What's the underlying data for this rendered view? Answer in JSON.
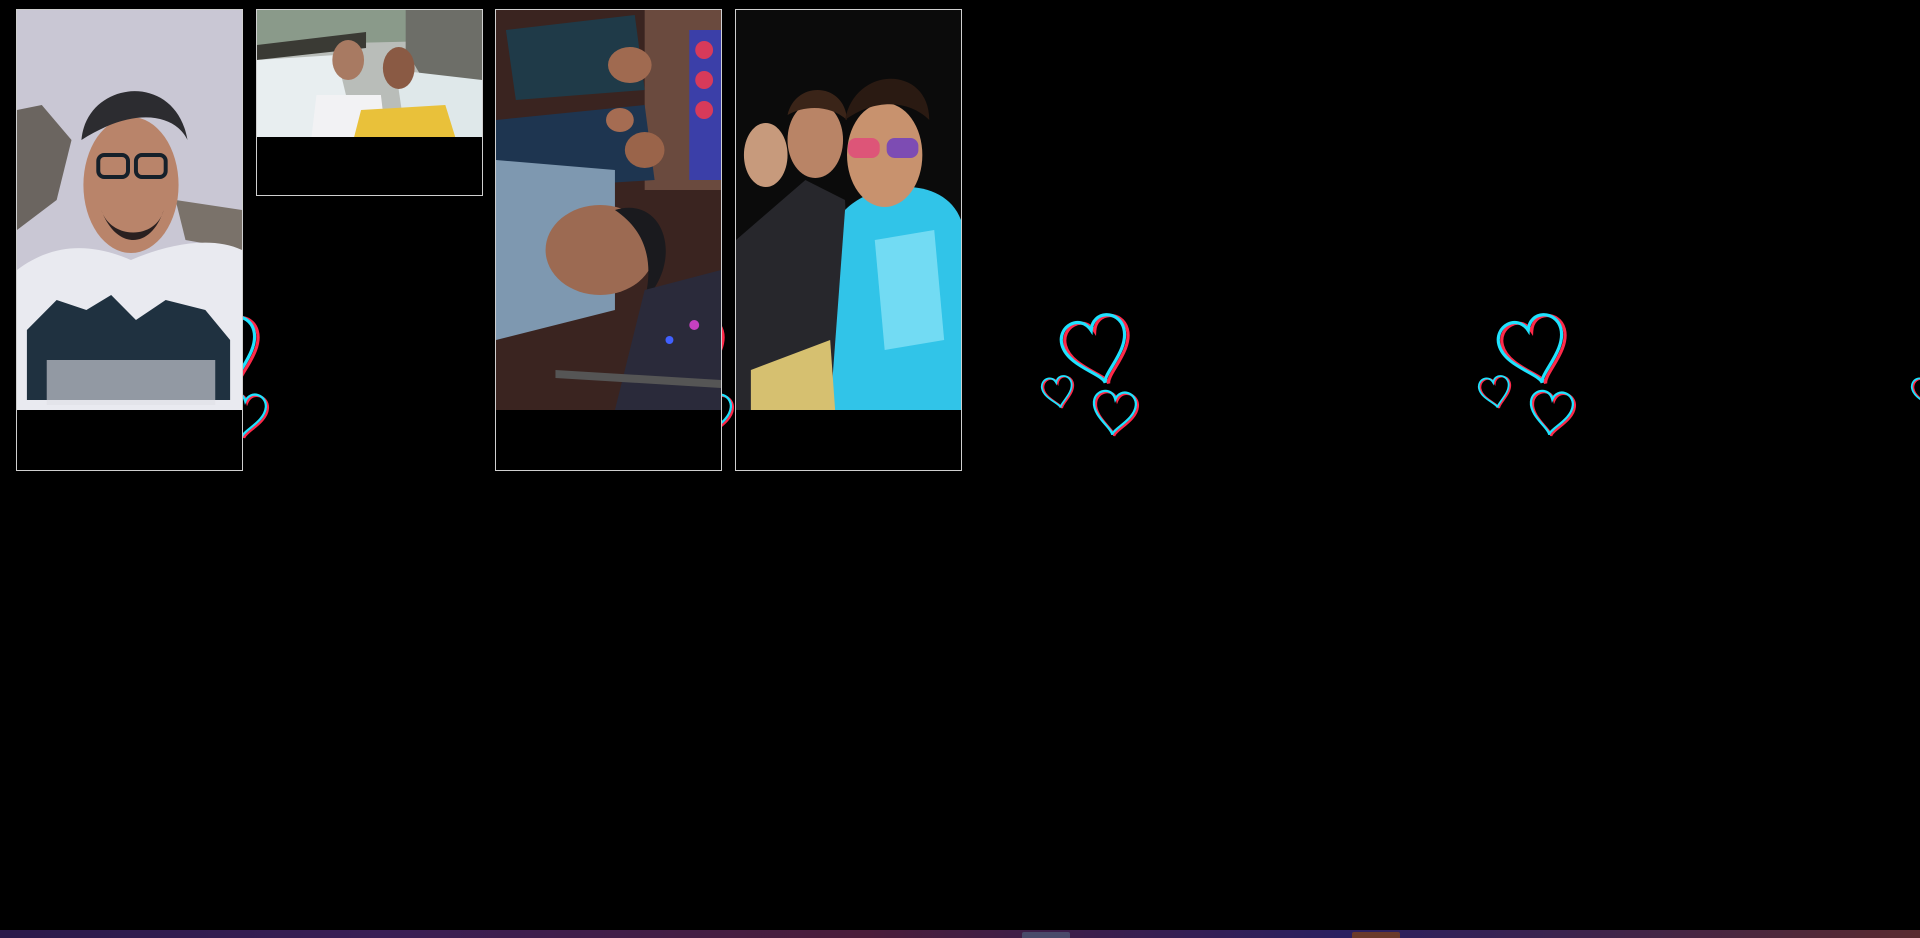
{
  "gallery": {
    "cards": [
      {
        "id": "photo-1",
        "subject": "selfie-with-glasses-white-tshirt"
      },
      {
        "id": "photo-2",
        "subject": "two-friends-at-waterfall"
      },
      {
        "id": "photo-3",
        "subject": "group-selfie-rotated"
      },
      {
        "id": "photo-4",
        "subject": "night-selfie-three-friends"
      }
    ],
    "sticker": "hearts-sticker-icon"
  },
  "colors": {
    "background": "#000000",
    "card_border": "#cfcfcf",
    "heart_cyan": "#1fe3ff",
    "heart_red": "#ff2a4a"
  }
}
